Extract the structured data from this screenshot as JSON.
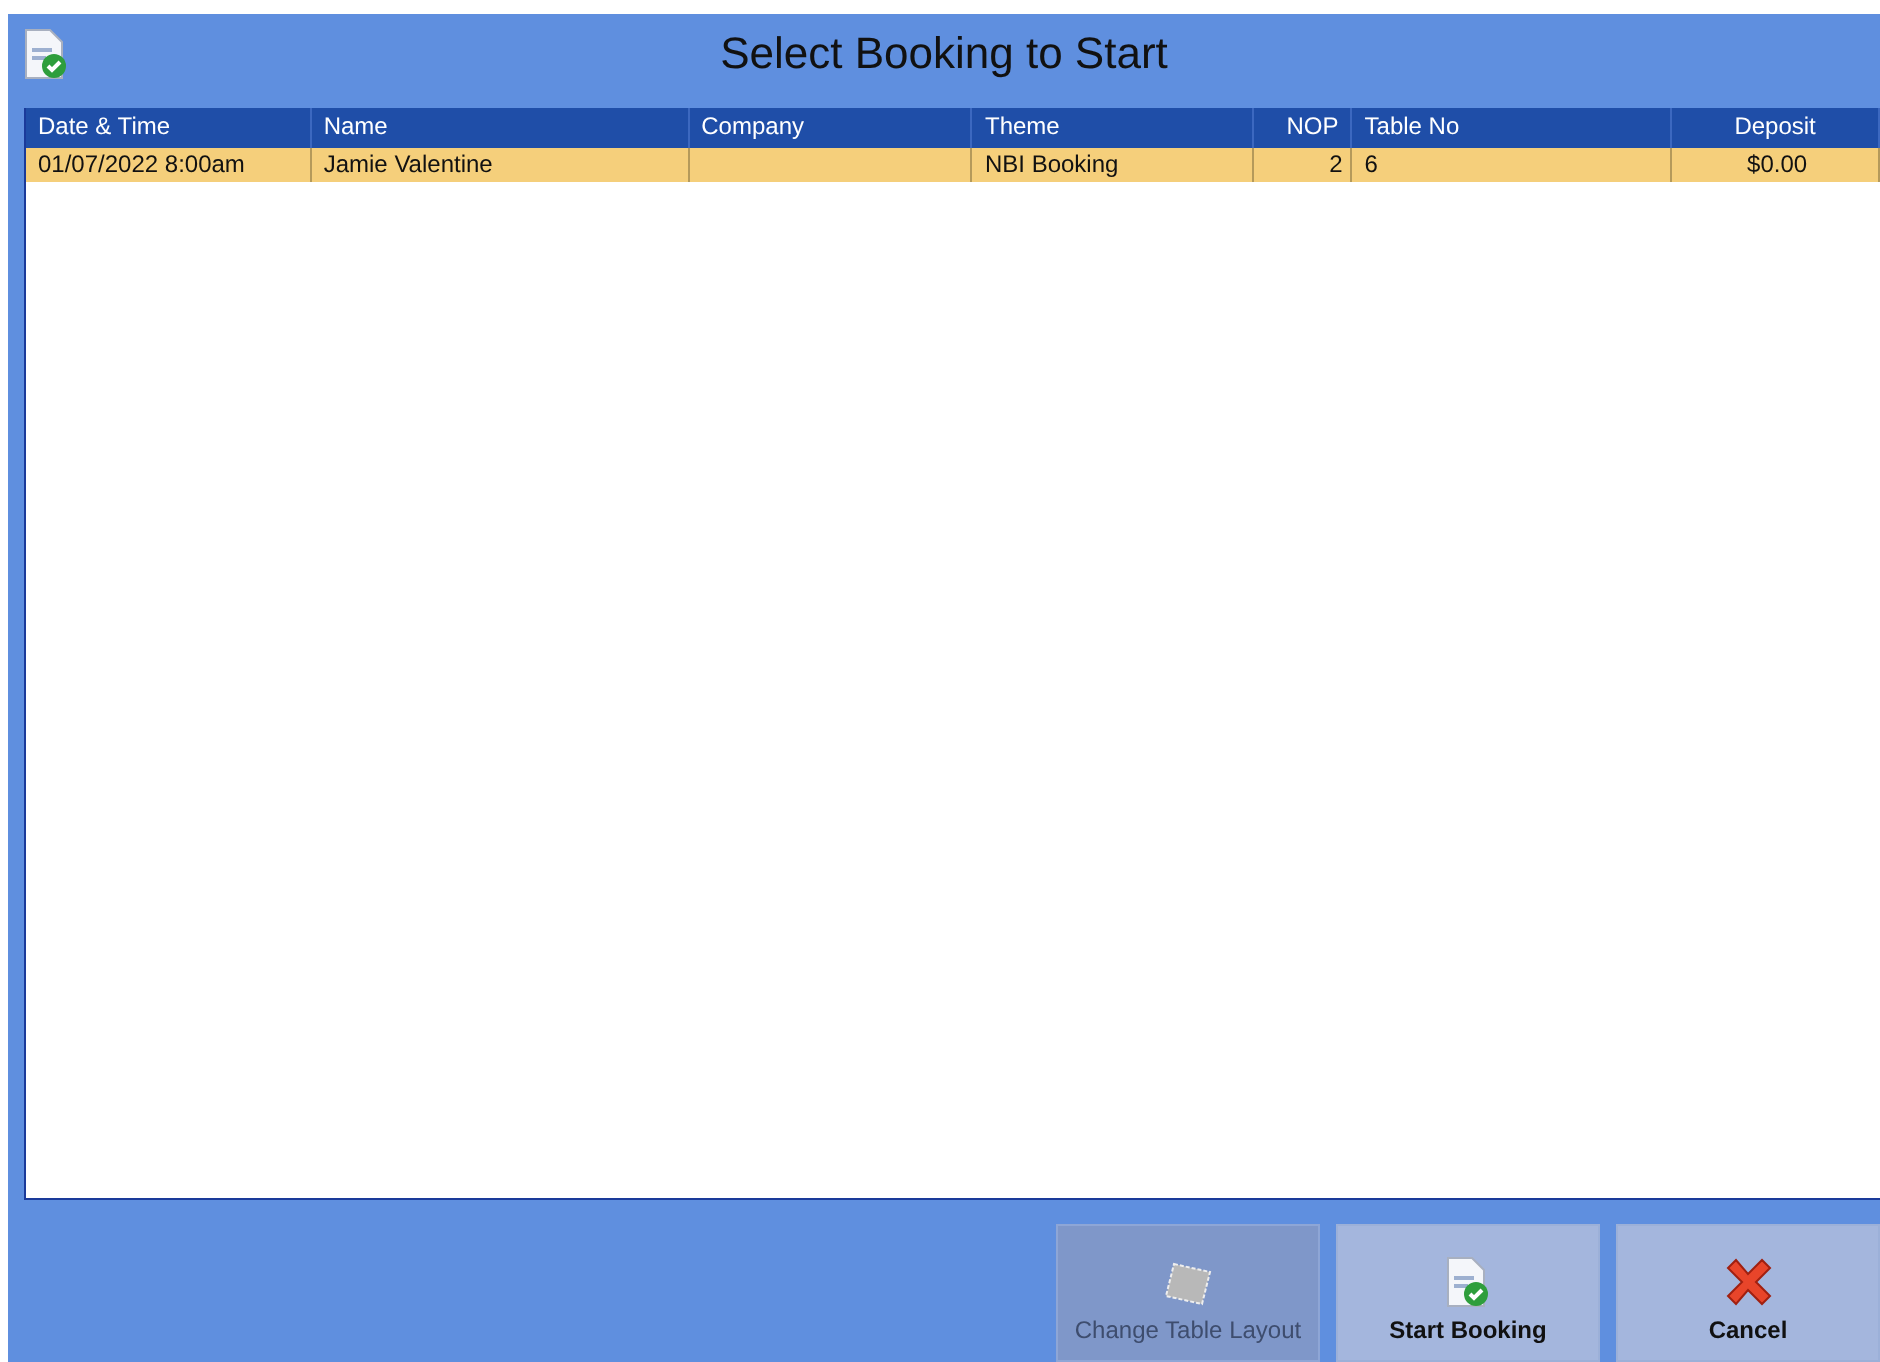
{
  "window": {
    "title": "Select Booking to Start"
  },
  "table": {
    "columns": [
      {
        "label": "Date & Time",
        "kind": "text"
      },
      {
        "label": "Name",
        "kind": "text"
      },
      {
        "label": "Company",
        "kind": "text"
      },
      {
        "label": "Theme",
        "kind": "text"
      },
      {
        "label": "NOP",
        "kind": "number"
      },
      {
        "label": "Table No",
        "kind": "text"
      },
      {
        "label": "Deposit",
        "kind": "money"
      }
    ],
    "rows": [
      {
        "selected": true,
        "cells": [
          "01/07/2022  8:00am",
          "Jamie Valentine",
          "",
          "NBI Booking",
          "2",
          "6",
          "$0.00"
        ]
      }
    ]
  },
  "buttons": [
    {
      "kind": "layout",
      "label": "Change Table Layout",
      "disabled": true
    },
    {
      "kind": "start",
      "label": "Start Booking",
      "disabled": false
    },
    {
      "kind": "cancel",
      "label": "Cancel",
      "disabled": false
    }
  ]
}
